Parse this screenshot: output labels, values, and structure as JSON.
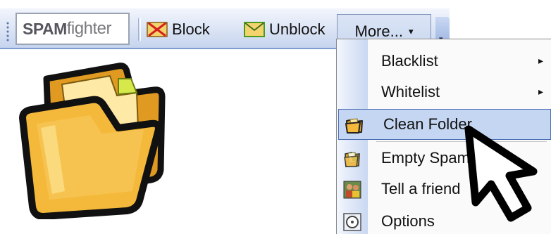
{
  "toolbar": {
    "logo_left": "SPAM",
    "logo_right": "fighter",
    "block_label": "Block",
    "unblock_label": "Unblock",
    "more_label": "More...",
    "more_arrow": "▾",
    "overflow_arrow": "▾"
  },
  "menu": {
    "items": [
      {
        "label": "Blacklist",
        "icon": "none",
        "submenu": "▸"
      },
      {
        "label": "Whitelist",
        "icon": "none",
        "submenu": "▸"
      },
      {
        "label": "Clean Folder",
        "icon": "folder-icon",
        "highlighted": true
      },
      {
        "label": "Empty Spam",
        "icon": "empty-spam-icon"
      },
      {
        "label": "Tell a friend",
        "icon": "friends-icon"
      },
      {
        "label": "Options",
        "icon": "options-icon"
      }
    ]
  },
  "colors": {
    "toolbar_bottom": "#c6d4ee",
    "highlight": "#c5d6f2",
    "highlight_border": "#4a6db4",
    "folder_yellow": "#f4b93a"
  }
}
